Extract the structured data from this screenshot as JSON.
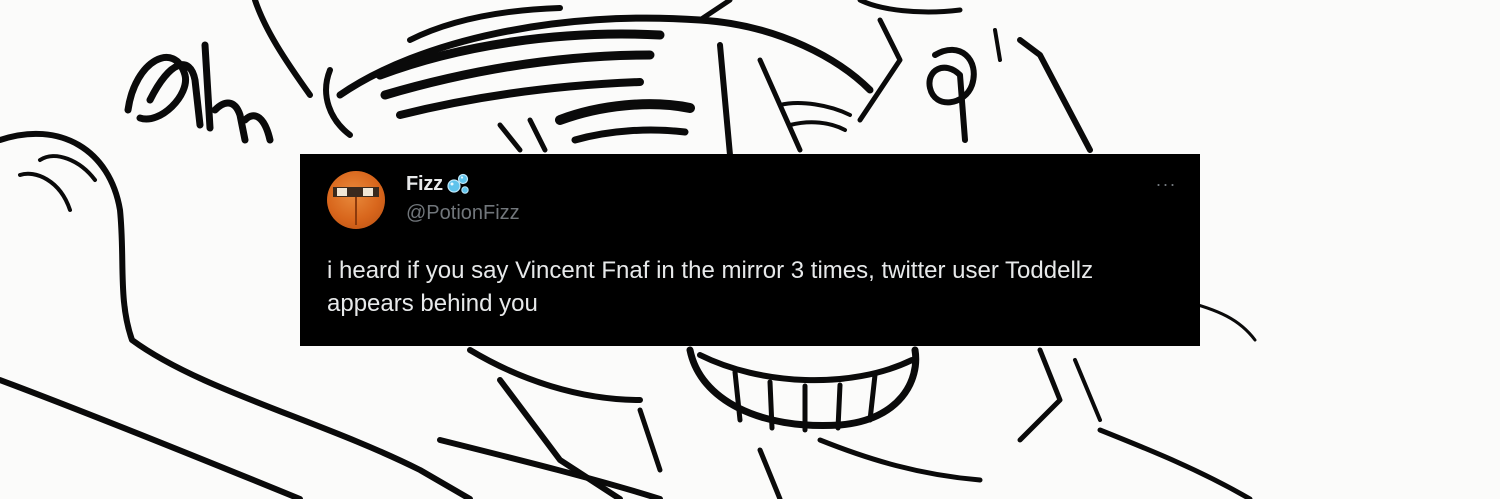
{
  "tweet": {
    "display_name": "Fizz",
    "handle": "@PotionFizz",
    "text": "i heard if you say Vincent Fnaf in the mirror 3 times, twitter user Toddellz appears behind you",
    "more_label": "···",
    "name_badge_icon": "bubbles-icon",
    "avatar_icon": "orange-mask-avatar"
  },
  "background": {
    "handwritten_text": "Ah"
  },
  "colors": {
    "card_background": "#000000",
    "name_text": "#e7e9ea",
    "handle_text": "#71767b",
    "avatar_orange": "#d8661c",
    "bubble_blue": "#5fc3ec"
  }
}
